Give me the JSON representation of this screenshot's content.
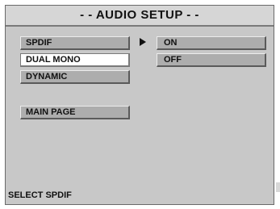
{
  "title": "- - AUDIO SETUP - -",
  "menu": {
    "spdif": "SPDIF",
    "dual_mono": "DUAL MONO",
    "dynamic": "DYNAMIC",
    "main_page": "MAIN PAGE"
  },
  "options": {
    "on": "ON",
    "off": "OFF"
  },
  "status": "SELECT SPDIF",
  "icons": {
    "selection_arrow": "play-arrow-icon"
  },
  "colors": {
    "background": "#c8c8c8",
    "button": "#adadad",
    "selected_button": "#ffffff",
    "text": "#111111"
  }
}
